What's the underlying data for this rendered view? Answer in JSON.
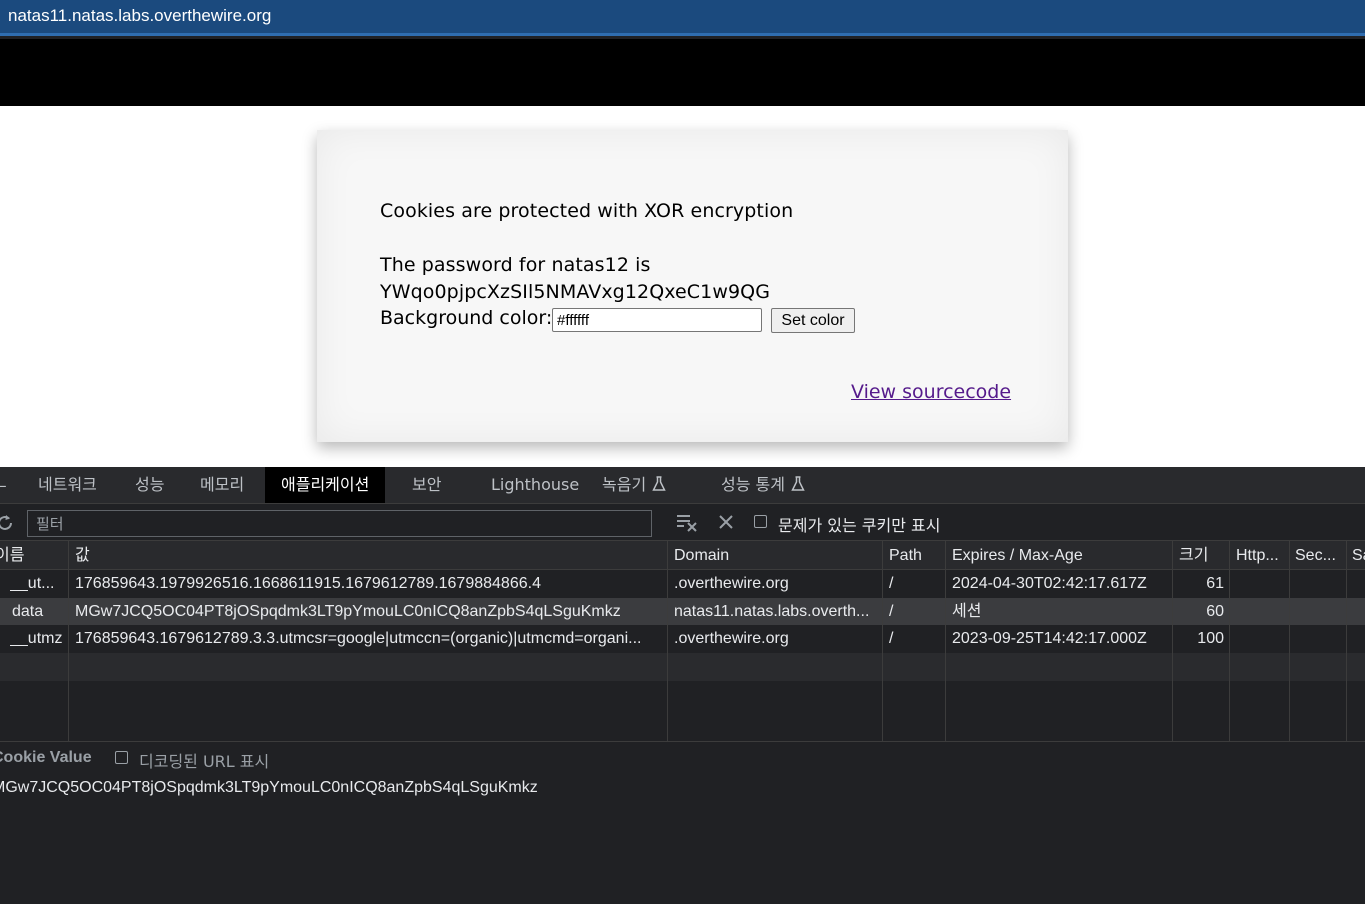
{
  "window": {
    "title": "natas11.natas.labs.overthewire.org"
  },
  "page": {
    "heading": "Cookies are protected with XOR encryption",
    "password_line": "The password for natas12 is",
    "password": "YWqo0pjpcXzSIl5NMAVxg12QxeC1w9QG",
    "bg_label": "Background color:",
    "bg_value": "#ffffff",
    "set_color_label": "Set color",
    "view_source_label": "View sourcecode"
  },
  "devtools": {
    "tabs": [
      {
        "label": "ㅗ"
      },
      {
        "label": "네트워크"
      },
      {
        "label": "성능"
      },
      {
        "label": "메모리"
      },
      {
        "label": "애플리케이션"
      },
      {
        "label": "보안"
      },
      {
        "label": "Lighthouse"
      },
      {
        "label": "녹음기"
      },
      {
        "label": "성능 통계"
      }
    ],
    "toolbar": {
      "filter_placeholder": "필터",
      "issues_only_label": "문제가 있는 쿠키만 표시"
    },
    "table": {
      "columns": [
        "이름",
        "값",
        "Domain",
        "Path",
        "Expires / Max-Age",
        "크기",
        "Http...",
        "Sec...",
        "Sa"
      ],
      "rows": [
        {
          "name": "__ut...",
          "value": "176859643.1979926516.1668611915.1679612789.1679884866.4",
          "domain": ".overthewire.org",
          "path": "/",
          "expires": "2024-04-30T02:42:17.617Z",
          "size": "61"
        },
        {
          "name": "data",
          "value": "MGw7JCQ5OC04PT8jOSpqdmk3LT9pYmouLC0nICQ8anZpbS4qLSguKmkz",
          "domain": "natas11.natas.labs.overth...",
          "path": "/",
          "expires": "세션",
          "size": "60"
        },
        {
          "name": "__utmz",
          "value": "176859643.1679612789.3.3.utmcsr=google|utmccn=(organic)|utmcmd=organi...",
          "domain": ".overthewire.org",
          "path": "/",
          "expires": "2023-09-25T14:42:17.000Z",
          "size": "100"
        }
      ]
    },
    "cookie_value": {
      "title": "Cookie Value",
      "show_decoded_label": "디코딩된 URL 표시",
      "value": "MGw7JCQ5OC04PT8jOSpqdmk3LT9pYmouLC0nICQ8anZpbS4qLSguKmkz"
    }
  },
  "colors": {
    "title_bar": "#1b4a7e",
    "link_visited": "#551a8b",
    "devtools_bg": "#202124",
    "selected_row": "#3b3c3f"
  }
}
